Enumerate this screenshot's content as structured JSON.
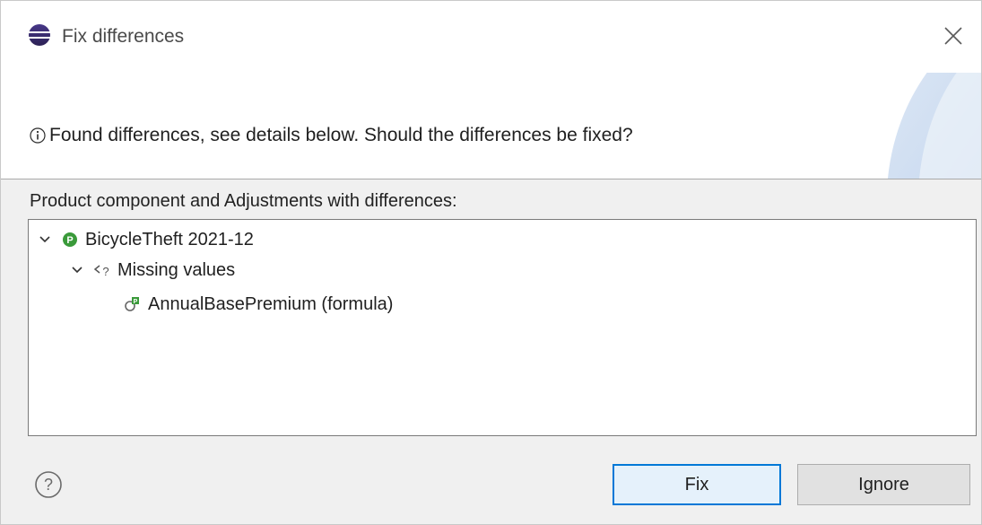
{
  "window": {
    "title": "Fix differences",
    "icon": "eclipse-icon",
    "close_icon": "close-icon"
  },
  "header": {
    "message": "Found differences, see details below. Should the differences be fixed?",
    "message_icon": "info-icon"
  },
  "tree": {
    "label": "Product component and Adjustments with differences:",
    "nodes": [
      {
        "label": "BicycleTheft 2021-12",
        "icon": "product-component-icon",
        "expanded": true
      },
      {
        "label": "Missing values",
        "icon": "missing-values-icon",
        "expanded": true
      },
      {
        "label": "AnnualBasePremium (formula)",
        "icon": "formula-icon"
      }
    ]
  },
  "footer": {
    "help_icon": "help-icon",
    "fix_label": "Fix",
    "ignore_label": "Ignore"
  },
  "colors": {
    "accent": "#0078d7",
    "product_green": "#3a9a3a",
    "dialog_bg": "#f0f0f0"
  }
}
